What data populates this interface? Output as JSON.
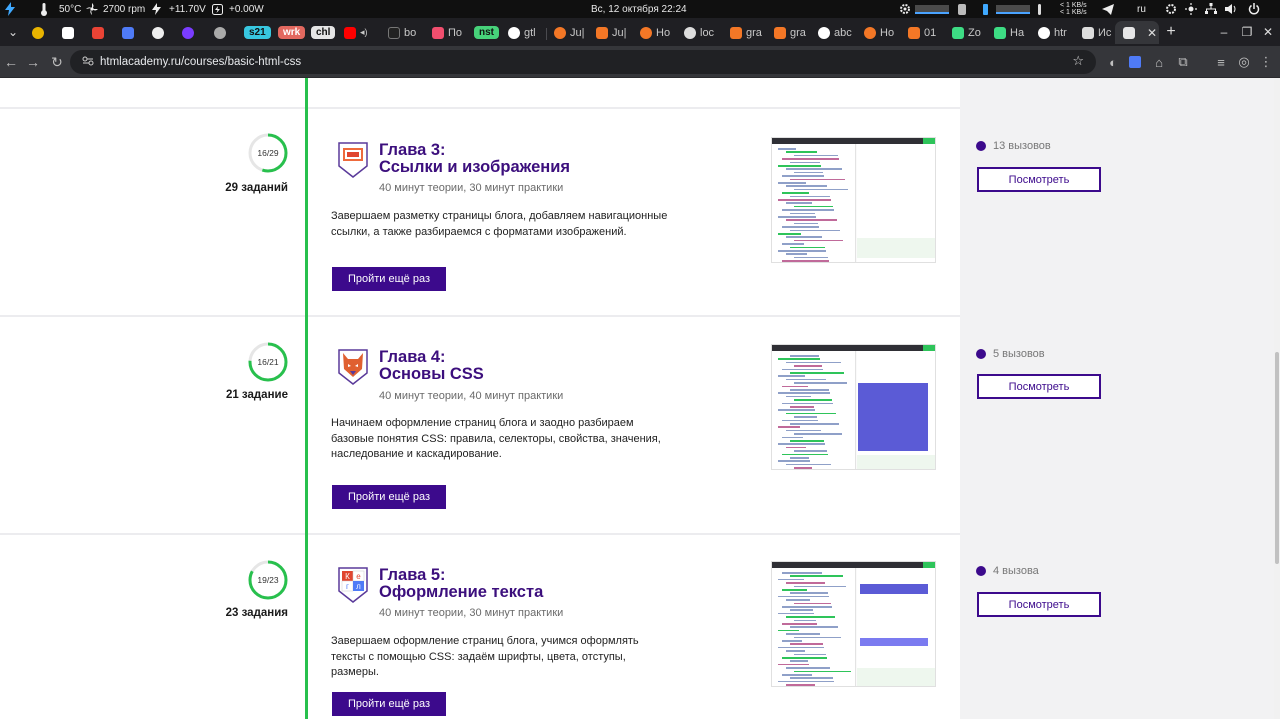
{
  "system": {
    "temperature": "50°C",
    "fan": "2700 rpm",
    "voltage": "+11.70V",
    "power": "+0.00W",
    "datetime": "Вс, 12 октября  22:24",
    "net_up": "< 1 KB/s",
    "net_down": "< 1 KB/s",
    "lang": "ru"
  },
  "tabs": {
    "pills": [
      "s21",
      "wrk",
      "chl",
      "nst"
    ],
    "labels": [
      "bo",
      "По",
      "gtl",
      "Ju|",
      "Ju|",
      "Ho",
      "loc",
      "gra",
      "gra",
      "abc",
      "Ho",
      "01",
      "Zo",
      "На",
      "htr",
      "Ис"
    ]
  },
  "browser": {
    "url": "htmlacademy.ru/courses/basic-html-css"
  },
  "chapters": [
    {
      "progress": "16/29",
      "progress_fraction": 0.55,
      "tasks": "29 заданий",
      "title_line1": "Глава 3:",
      "title_line2": "Ссылки и изображения",
      "meta": "40 минут теории, 30 минут практики",
      "description": "Завершаем разметку страницы блога, добавляем навигационные ссылки, а также разбираемся с форматами изображений.",
      "button": "Пройти ещё раз",
      "calls": "13 вызовов",
      "view_button": "Посмотреть",
      "badge_icon": "chapter-3-badge-icon"
    },
    {
      "progress": "16/21",
      "progress_fraction": 0.76,
      "tasks": "21 задание",
      "title_line1": "Глава 4:",
      "title_line2": "Основы CSS",
      "meta": "40 минут теории, 40 минут практики",
      "description": "Начинаем оформление страниц блога и заодно разбираем базовые понятия CSS: правила, селекторы, свойства, значения, наследование и каскадирование.",
      "button": "Пройти ещё раз",
      "calls": "5 вызовов",
      "view_button": "Посмотреть",
      "badge_icon": "chapter-4-fox-badge-icon"
    },
    {
      "progress": "19/23",
      "progress_fraction": 0.83,
      "tasks": "23 задания",
      "title_line1": "Глава 5:",
      "title_line2": "Оформление текста",
      "meta": "40 минут теории, 30 минут практики",
      "description": "Завершаем оформление страниц блога, учимся оформлять тексты с помощью CSS: задаём шрифты, цвета, отступы, размеры.",
      "button": "Пройти ещё раз",
      "calls": "4 вызова",
      "view_button": "Посмотреть",
      "badge_icon": "chapter-5-kegl-badge-icon",
      "badge_letters": [
        "К",
        "е",
        "г",
        "л"
      ]
    }
  ],
  "colors": {
    "accent": "#3c0a8c",
    "progress_green": "#28c04d",
    "sidebar_bg": "#f2f2f3"
  }
}
